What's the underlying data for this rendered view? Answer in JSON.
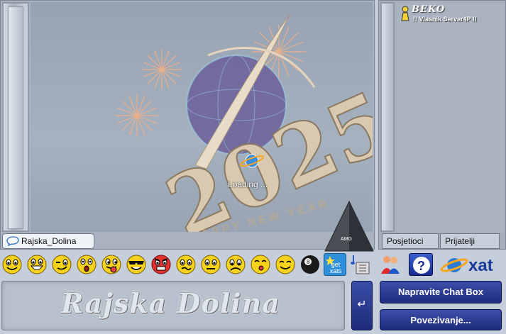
{
  "chat": {
    "group_name": "Rajska_Dolina",
    "loading_text": "Loading ...",
    "banner_year": "2025",
    "banner_subtitle": "HAPPY NEW YEAR",
    "badge_label": "AMG"
  },
  "users": {
    "list": [
      {
        "name": "BEKO",
        "status": "!! Vlasnik Server4P !!"
      }
    ],
    "tabs": [
      {
        "label": "Posjetioci"
      },
      {
        "label": "Prijatelji"
      }
    ]
  },
  "toolbar": {
    "smileys": [
      "smile",
      "biggrin",
      "wink",
      "eek",
      "tongue",
      "cool",
      "mad",
      "confused",
      "frown",
      "sad",
      "kiss",
      "red-smile"
    ],
    "getxats_label": "get xats",
    "logo_text": "xat"
  },
  "bottom": {
    "message_title": "Rajska Dolina",
    "send_symbol": "↵",
    "make_chat_label": "Napravite Chat Box",
    "connect_label": "Povezivanje..."
  },
  "colors": {
    "button_blue": "#2a3a92",
    "smiley_yellow": "#f6d21c",
    "background": "#c5ceda"
  }
}
